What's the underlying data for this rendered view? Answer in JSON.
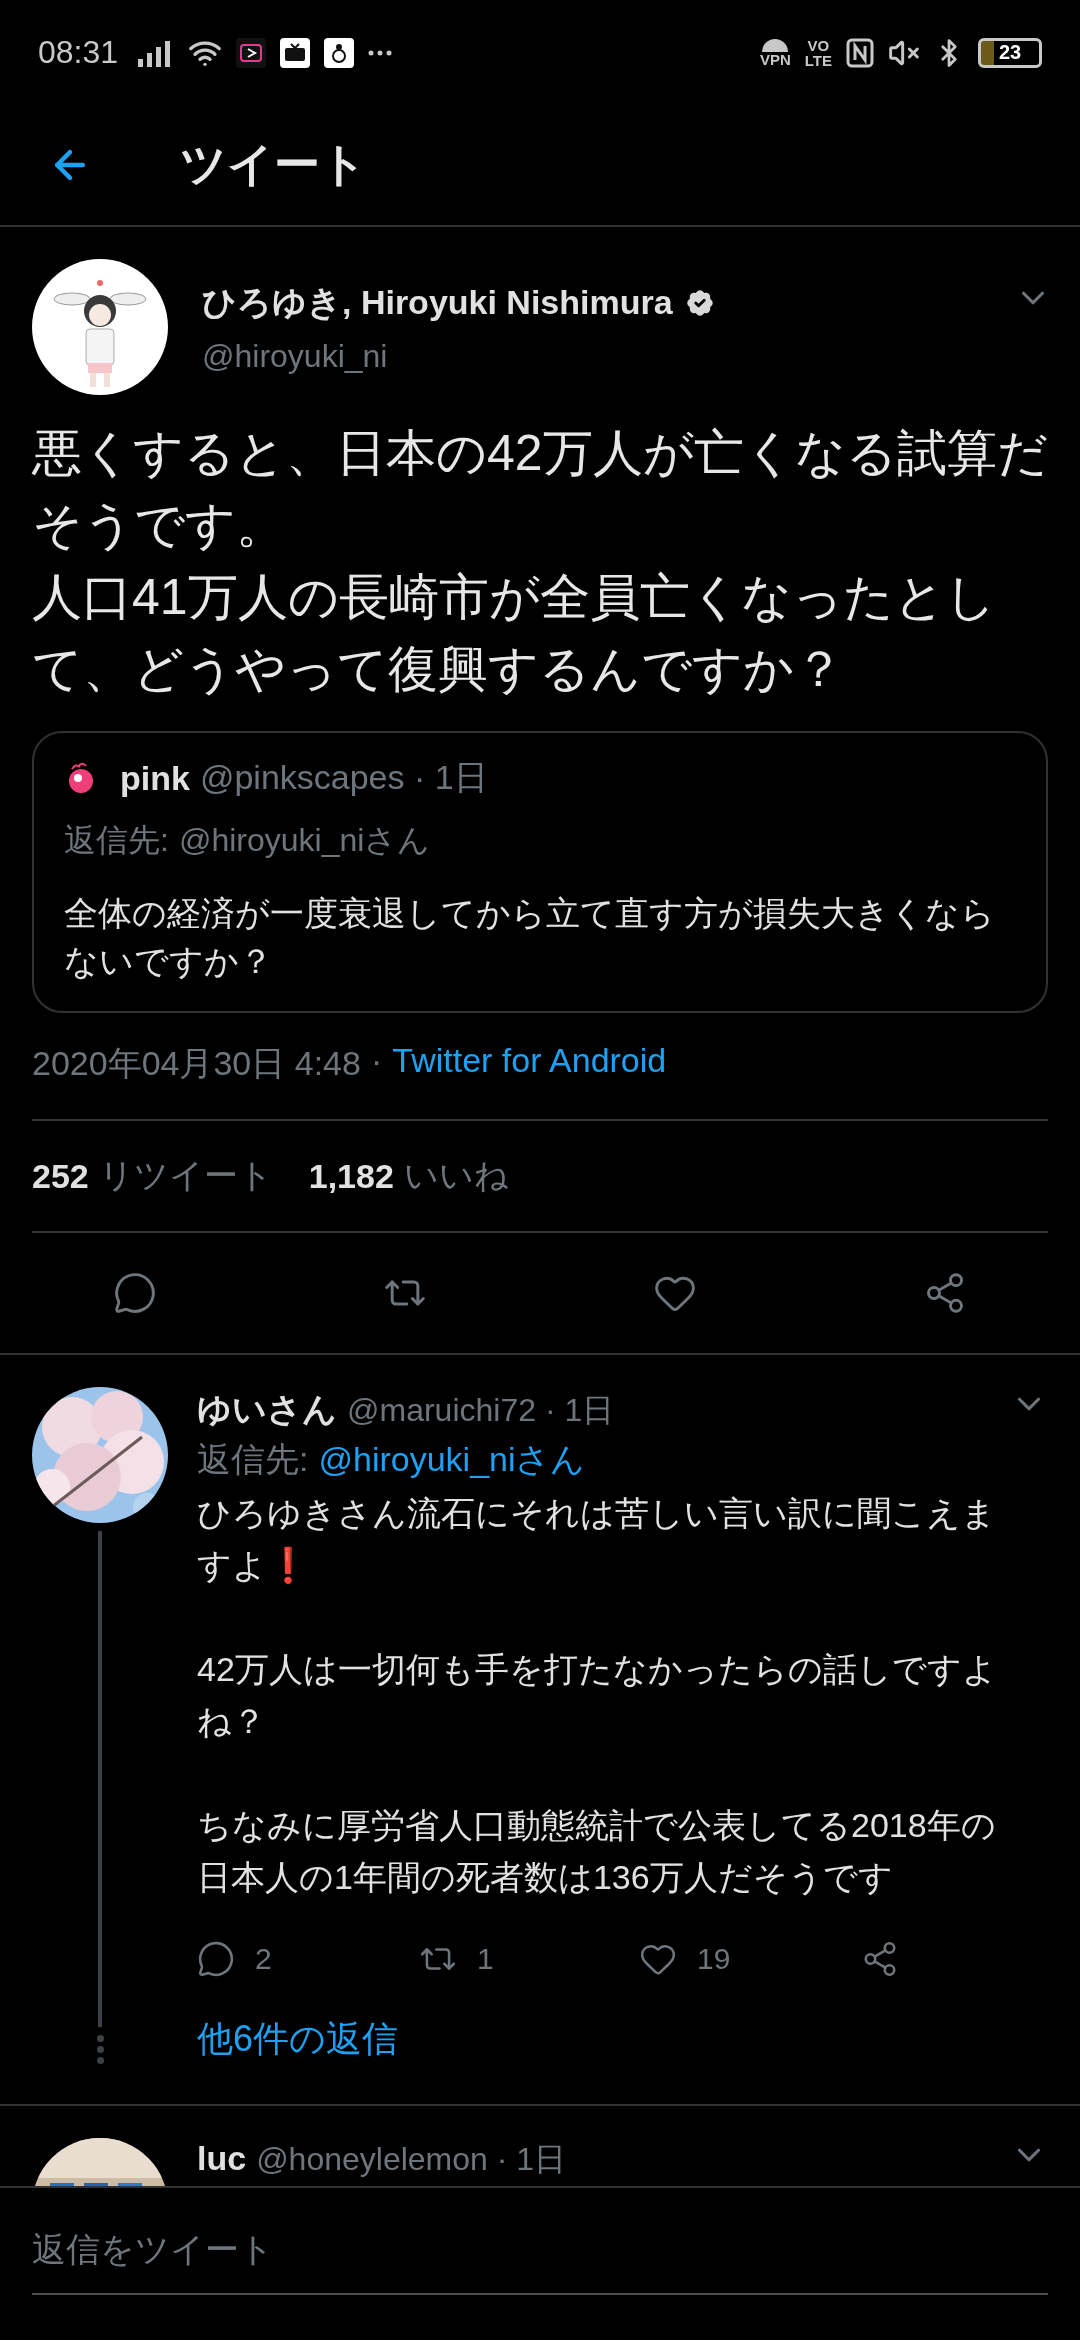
{
  "status_bar": {
    "time": "08:31",
    "indicators": [
      "VPN",
      "VO",
      "LTE"
    ],
    "battery": "23"
  },
  "header": {
    "title": "ツイート"
  },
  "tweet": {
    "author": "ひろゆき, Hiroyuki Nishimura",
    "verified": true,
    "handle": "@hiroyuki_ni",
    "paragraphs": [
      "悪くすると、日本の42万人が亡くなる試算だそうです。",
      "人口41万人の長崎市が全員亡くなったとして、どうやって復興するんですか？"
    ],
    "quote": {
      "author": "pink",
      "meta": "@pinkscapes · 1日",
      "reply_to_label": "返信先:",
      "reply_to": "@hiroyuki_niさん",
      "text": "全体の経済が一度衰退してから立て直す方が損失大きくならないですか？"
    },
    "date": "2020年04月30日 4:48",
    "separator": "·",
    "source": "Twitter for Android",
    "stats": [
      {
        "count": "252",
        "label": "リツイート"
      },
      {
        "count": "1,182",
        "label": "いいね"
      }
    ],
    "actions": [
      {
        "kind": "reply"
      },
      {
        "kind": "retweet"
      },
      {
        "kind": "like"
      },
      {
        "kind": "share"
      }
    ]
  },
  "replies": [
    {
      "author": "ゆいさん",
      "meta": "@maruichi72 · 1日",
      "reply_to_label": "返信先:",
      "reply_to": "@hiroyuki_niさん",
      "paragraphs": [
        "ひろゆきさん流石にそれは苦しい言い訳に聞こえますよ❗",
        "42万人は一切何も手を打たなかったらの話しですよね？",
        "ちなみに厚労省人口動態統計で公表してる2018年の日本人の1年間の死者数は136万人だそうです"
      ],
      "actions": [
        {
          "kind": "reply",
          "count": "2"
        },
        {
          "kind": "retweet",
          "count": "1"
        },
        {
          "kind": "like",
          "count": "19"
        },
        {
          "kind": "share"
        }
      ],
      "more": "他6件の返信"
    },
    {
      "author": "luc",
      "meta": "@honeylelemon · 1日"
    }
  ],
  "compose": {
    "placeholder": "返信をツイート"
  }
}
